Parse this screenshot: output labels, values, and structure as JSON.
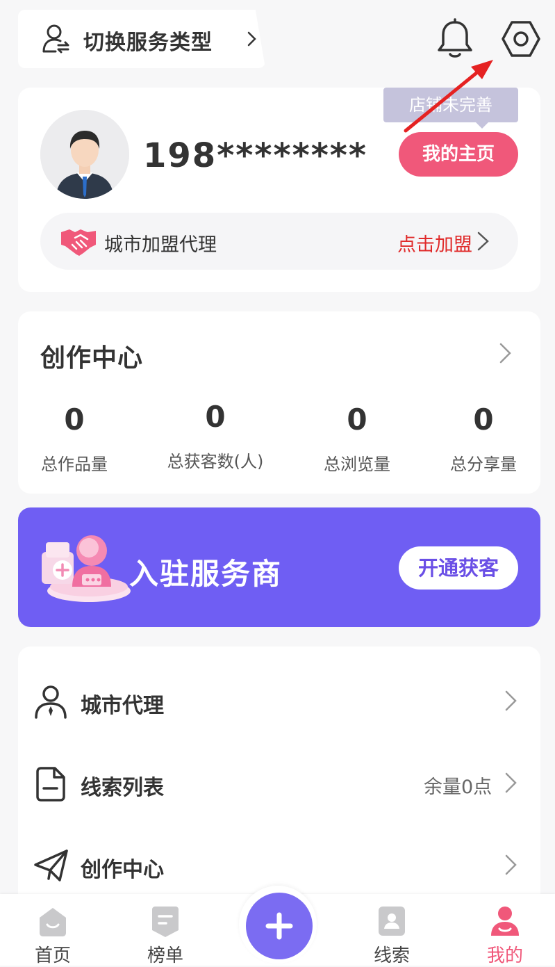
{
  "header": {
    "switch_label": "切换服务类型"
  },
  "profile": {
    "phone": "198********",
    "tooltip": "店铺未完善",
    "home_button": "我的主页",
    "join": {
      "label": "城市加盟代理",
      "action": "点击加盟"
    }
  },
  "creation": {
    "title": "创作中心",
    "stats": [
      {
        "value": "0",
        "label": "总作品量"
      },
      {
        "value": "0",
        "label": "总获客数(人)"
      },
      {
        "value": "0",
        "label": "总浏览量"
      },
      {
        "value": "0",
        "label": "总分享量"
      }
    ]
  },
  "banner": {
    "title": "入驻服务商",
    "cta": "开通获客"
  },
  "menu": [
    {
      "label": "城市代理",
      "extra": ""
    },
    {
      "label": "线索列表",
      "extra": "余量0点"
    },
    {
      "label": "创作中心",
      "extra": ""
    }
  ],
  "tabbar": {
    "items": [
      {
        "label": "首页"
      },
      {
        "label": "榜单"
      },
      {
        "label": "线索"
      },
      {
        "label": "我的"
      }
    ],
    "active": "我的"
  },
  "colors": {
    "accent_pink": "#f0587a",
    "banner_purple": "#6f5ef3",
    "fab_purple": "#7b6cf2",
    "link_red": "#e02a2a",
    "annotation_arrow": "#e52222"
  }
}
